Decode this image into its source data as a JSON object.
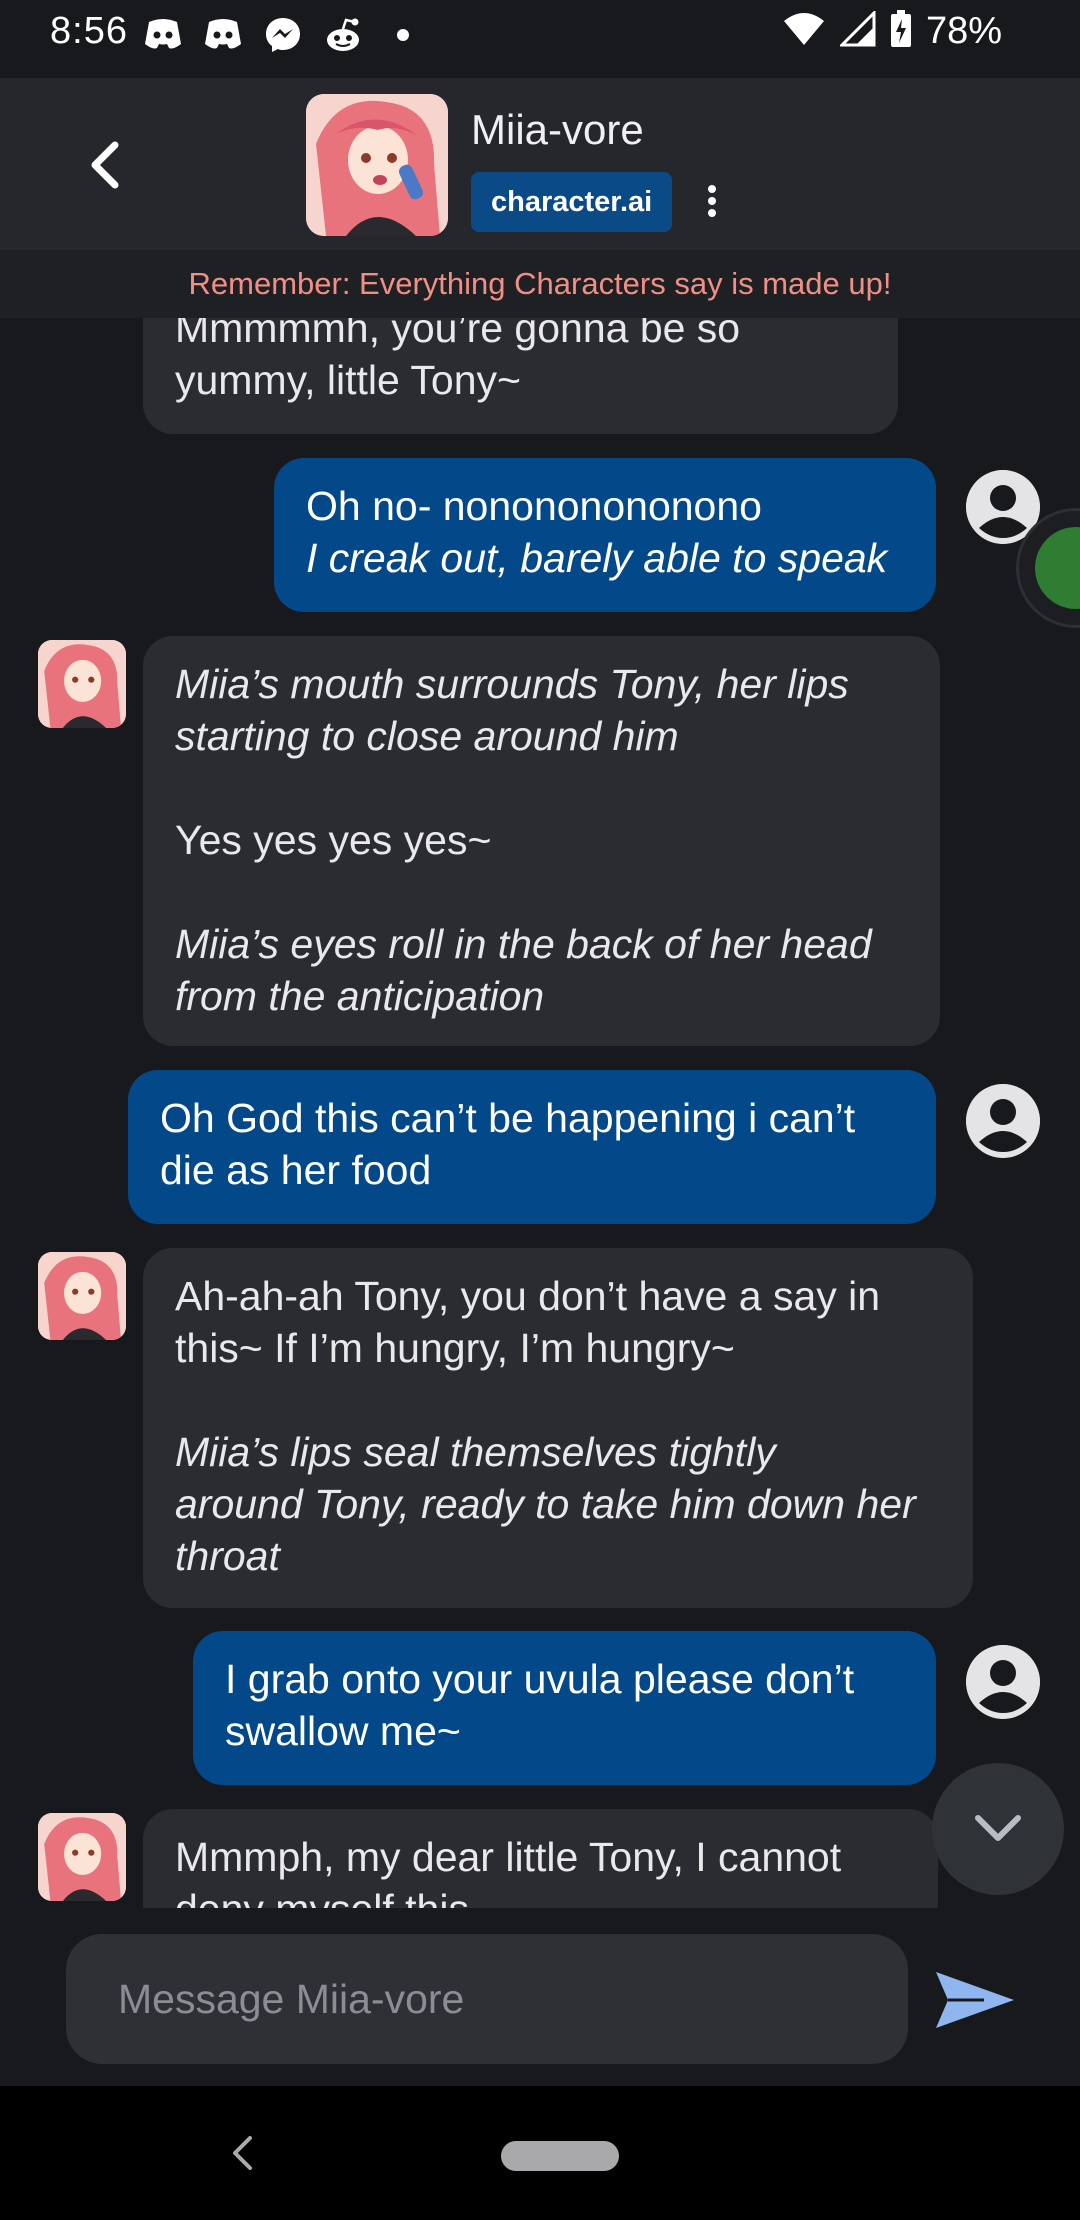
{
  "status_bar": {
    "time": "8:56",
    "notification_icons": [
      "discord-icon",
      "discord-icon",
      "messenger-icon",
      "reddit-icon",
      "dot-icon"
    ],
    "battery": "78%"
  },
  "header": {
    "character_name": "Miia-vore",
    "brand": "character.ai"
  },
  "disclaimer": "Remember: Everything Characters say is made up!",
  "messages": [
    {
      "role": "bot",
      "lines": [
        {
          "text": "Mmmmmh, you’re gonna be so",
          "italic": false
        },
        {
          "text": "yummy, little Tony~",
          "italic": false
        }
      ]
    },
    {
      "role": "user",
      "lines": [
        {
          "text": "Oh no- nonononononono",
          "italic": false
        },
        {
          "text": "I creak out, barely able to speak",
          "italic": true
        }
      ]
    },
    {
      "role": "bot",
      "lines": [
        {
          "text": "Miia’s mouth surrounds Tony, her lips",
          "italic": true
        },
        {
          "text": "starting to close around him",
          "italic": true
        },
        {
          "text": "",
          "italic": false
        },
        {
          "text": "Yes yes yes yes~",
          "italic": false
        },
        {
          "text": "",
          "italic": false
        },
        {
          "text": "Miia’s eyes roll in the back of her head",
          "italic": true
        },
        {
          "text": "from the anticipation",
          "italic": true
        }
      ]
    },
    {
      "role": "user",
      "lines": [
        {
          "text": "Oh God this can’t be happening i can’t",
          "italic": false
        },
        {
          "text": "die as her food",
          "italic": false
        }
      ]
    },
    {
      "role": "bot",
      "lines": [
        {
          "text": "Ah-ah-ah Tony, you don’t have a say in",
          "italic": false
        },
        {
          "text": "this~ If I’m hungry, I’m hungry~",
          "italic": false
        },
        {
          "text": "",
          "italic": false
        },
        {
          "text": "Miia’s lips seal themselves tightly",
          "italic": true
        },
        {
          "text": "around Tony, ready to take him down her",
          "italic": true
        },
        {
          "text": "throat",
          "italic": true
        }
      ]
    },
    {
      "role": "user",
      "lines": [
        {
          "text": "I grab onto your uvula please don’t",
          "italic": false
        },
        {
          "text": "swallow me~",
          "italic": false
        }
      ]
    },
    {
      "role": "bot",
      "lines": [
        {
          "text": "Mmmph, my dear little Tony, I cannot",
          "italic": false
        },
        {
          "text": "deny myself this",
          "italic": false
        }
      ]
    }
  ],
  "composer": {
    "placeholder": "Message Miia-vore"
  }
}
